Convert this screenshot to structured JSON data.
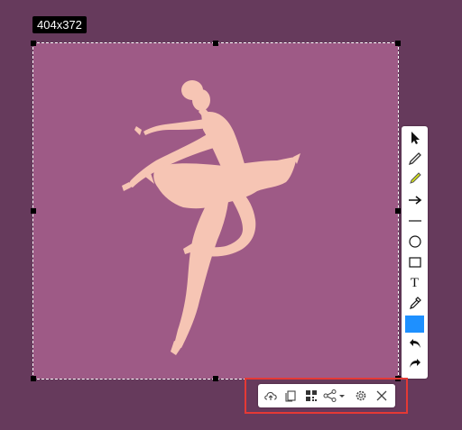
{
  "selection": {
    "size_label": "404x372"
  },
  "image": {
    "subject": "ballerina-silhouette",
    "background_color": "#9e5a86",
    "figure_color": "#f6c5b4"
  },
  "colors": {
    "overlay": "#663a5c",
    "current_color": "#1e90ff",
    "highlight": "#e53935"
  },
  "vertical_toolbar": {
    "tools": [
      "select-cursor-icon",
      "pen-icon",
      "highlighter-icon",
      "arrow-icon",
      "line-icon",
      "ellipse-icon",
      "rectangle-icon",
      "text-icon",
      "color-picker-icon",
      "color-swatch",
      "undo-icon",
      "redo-icon"
    ],
    "text_tool_glyph": "T"
  },
  "horizontal_toolbar": {
    "actions": [
      "upload-cloud-icon",
      "copy-icon",
      "qr-code-icon",
      "share-icon",
      "settings-icon",
      "close-icon"
    ]
  }
}
